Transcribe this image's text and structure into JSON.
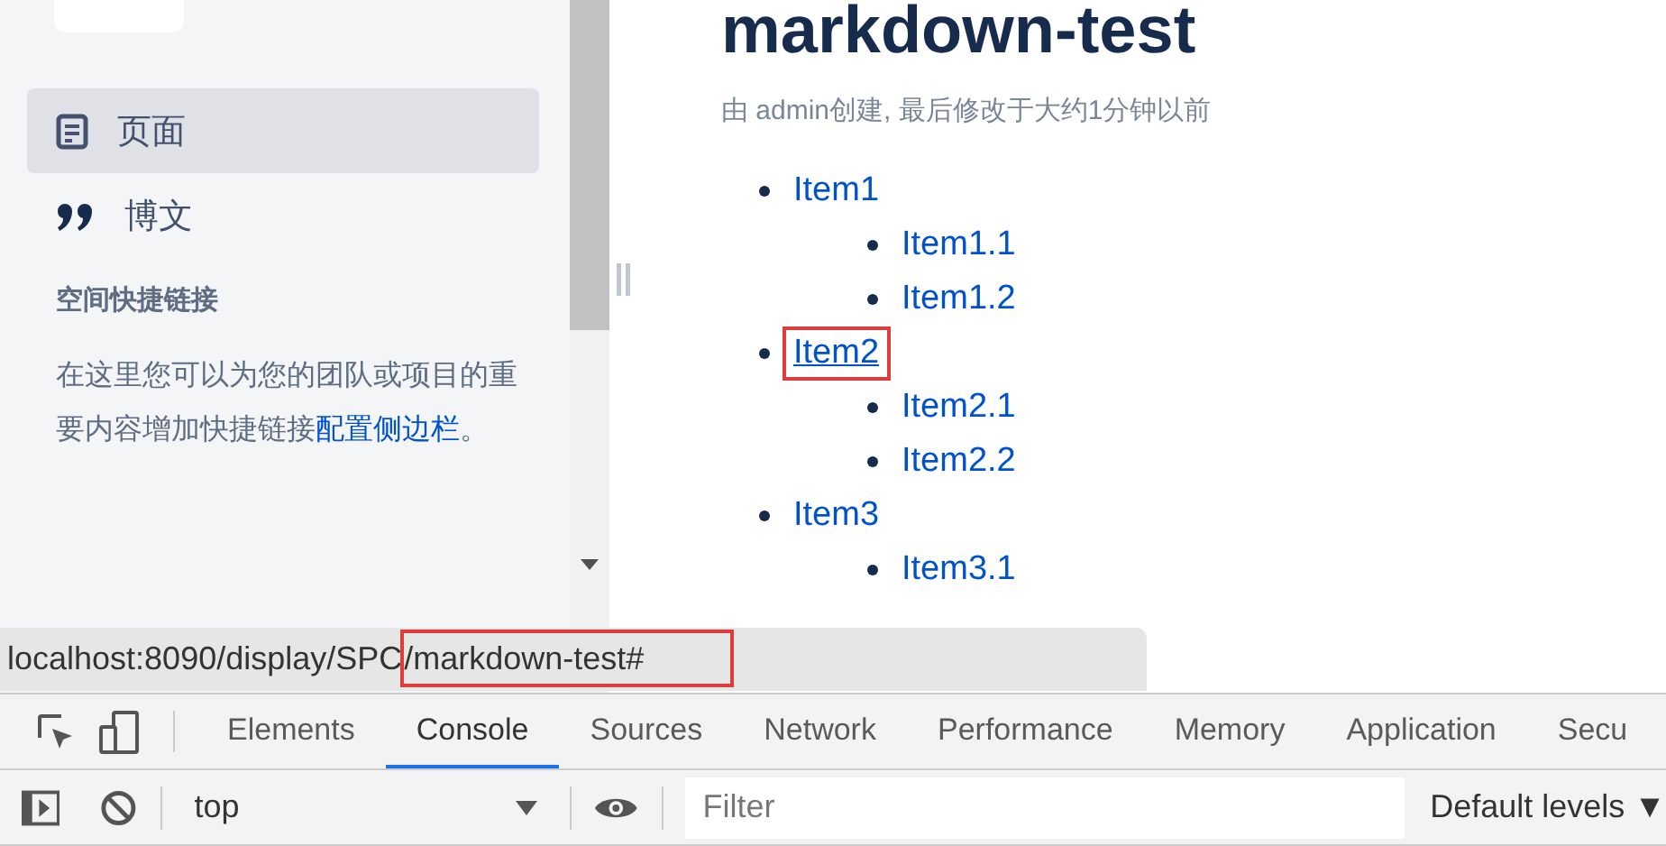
{
  "sidebar": {
    "nav": [
      {
        "label": "页面",
        "selected": true
      },
      {
        "label": "博文",
        "selected": false
      }
    ],
    "shortcuts": {
      "heading": "空间快捷链接",
      "text": "在这里您可以为您的团队或项目的重要内容增加快捷链接",
      "link": "配置侧边栏",
      "after": "。"
    }
  },
  "page": {
    "title": "markdown-test",
    "byline": "由 admin创建, 最后修改于大约1分钟以前",
    "list": [
      {
        "label": "Item1",
        "highlighted": false,
        "children": [
          {
            "label": "Item1.1",
            "highlighted": false
          },
          {
            "label": "Item1.2",
            "highlighted": false
          }
        ]
      },
      {
        "label": "Item2",
        "highlighted": true,
        "children": [
          {
            "label": "Item2.1",
            "highlighted": false
          },
          {
            "label": "Item2.2",
            "highlighted": false
          }
        ]
      },
      {
        "label": "Item3",
        "highlighted": false,
        "children": [
          {
            "label": "Item3.1",
            "highlighted": false
          }
        ]
      }
    ]
  },
  "status_url": {
    "prefix": "localhost:8090/display/SPC",
    "highlighted": "/markdown-test#"
  },
  "devtools": {
    "tabs": [
      {
        "label": "Elements",
        "selected": false
      },
      {
        "label": "Console",
        "selected": true
      },
      {
        "label": "Sources",
        "selected": false
      },
      {
        "label": "Network",
        "selected": false
      },
      {
        "label": "Performance",
        "selected": false
      },
      {
        "label": "Memory",
        "selected": false
      },
      {
        "label": "Application",
        "selected": false
      },
      {
        "label": "Secu",
        "selected": false
      }
    ],
    "context": "top",
    "filter_placeholder": "Filter",
    "levels": "Default levels ▼"
  }
}
